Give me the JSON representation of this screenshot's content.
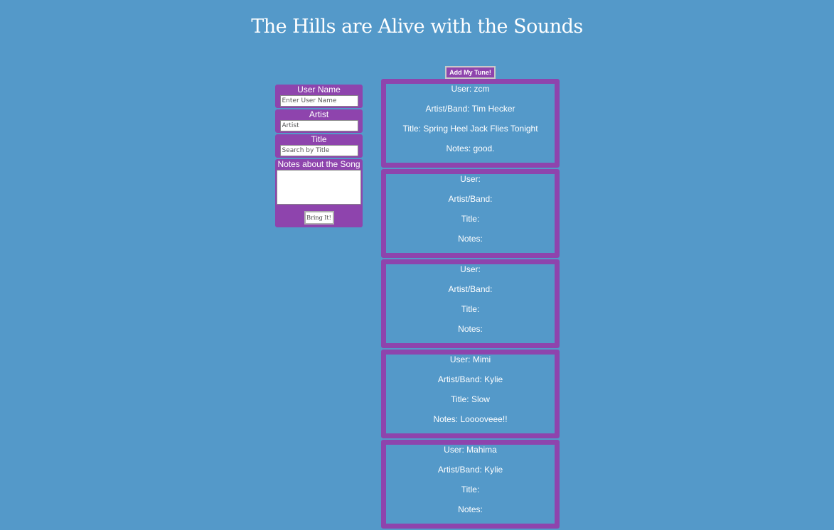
{
  "header": {
    "title": "The Hills are Alive with the Sounds"
  },
  "form": {
    "user_label": "User Name",
    "user_placeholder": "Enter User Name",
    "artist_label": "Artist",
    "artist_placeholder": "Artist",
    "title_label": "Title",
    "title_placeholder": "Search by Title",
    "notes_label": "Notes about the Song",
    "submit_label": "Bring It!"
  },
  "toolbar": {
    "add_label": "Add My Tune!"
  },
  "tunes": [
    {
      "user": "User: zcm",
      "artist": "Artist/Band: Tim Hecker",
      "title": "Title: Spring Heel Jack Flies Tonight",
      "notes": "Notes: good."
    },
    {
      "user": "User:",
      "artist": "Artist/Band:",
      "title": "Title:",
      "notes": "Notes:"
    },
    {
      "user": "User:",
      "artist": "Artist/Band:",
      "title": "Title:",
      "notes": "Notes:"
    },
    {
      "user": "User: Mimi",
      "artist": "Artist/Band: Kylie",
      "title": "Title: Slow",
      "notes": "Notes: Looooveee!!"
    },
    {
      "user": "User: Mahima",
      "artist": "Artist/Band: Kylie",
      "title": "Title:",
      "notes": "Notes:"
    }
  ],
  "colors": {
    "background": "#5499c9",
    "accent": "#8e44ad",
    "text": "#ffffff"
  }
}
